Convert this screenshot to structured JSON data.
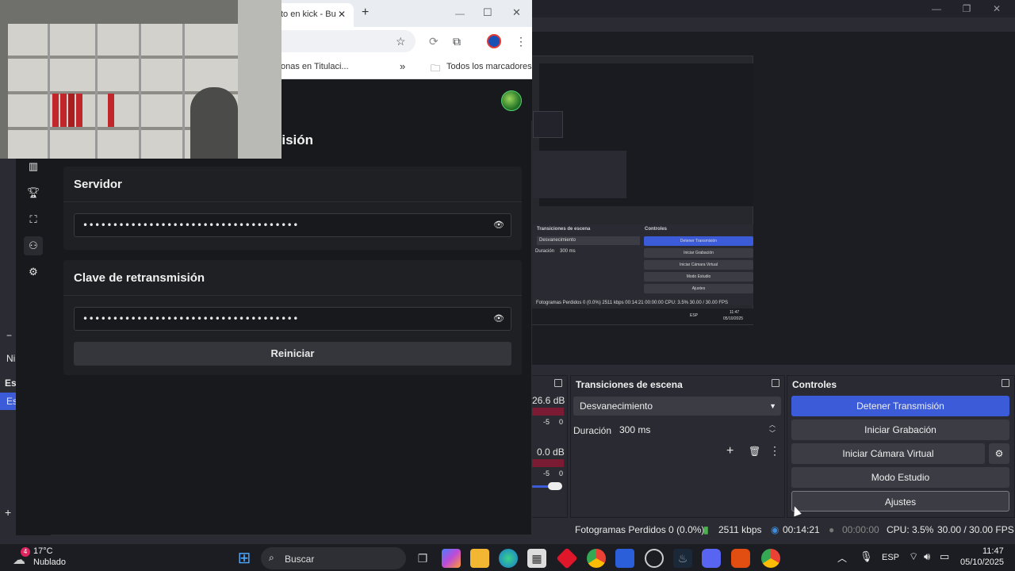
{
  "browser": {
    "tab_title": "to en kick - Bu",
    "new_tab": "+",
    "bookmarks_partial": "onas en Titulaci...",
    "bookmarks_more": "»",
    "all_bookmarks": "Todos los marcadores"
  },
  "kick": {
    "section_title_partial": "nisión",
    "server_card": {
      "title": "Servidor",
      "dots": "••••••••••••••••••••••••••••••••••••"
    },
    "key_card": {
      "title": "Clave de retransmisión",
      "dots": "••••••••••••••••••••••••••••••••••••"
    },
    "reset_label": "Reiniciar",
    "sidebar_icons": [
      "chart-icon",
      "trophy-icon",
      "scan-icon",
      "user-settings-icon",
      "gear-icon"
    ]
  },
  "obs": {
    "left_partial": {
      "minus": "−",
      "ni": "Ni",
      "es": "Es",
      "es2": "Es",
      "plus": "+"
    },
    "audio": {
      "db1": "26.6 dB",
      "scale1": [
        "-5",
        "0"
      ],
      "db2": "0.0 dB",
      "scale2": [
        "-5",
        "0"
      ]
    },
    "transitions": {
      "title": "Transiciones de escena",
      "transition": "Desvanecimiento",
      "duration_label": "Duración",
      "duration_value": "300 ms"
    },
    "controls": {
      "title": "Controles",
      "stop_stream": "Detener Transmisión",
      "start_recording": "Iniciar Grabación",
      "virtual_cam": "Iniciar Cámara Virtual",
      "studio_mode": "Modo Estudio",
      "settings": "Ajustes"
    },
    "status": {
      "dropped_frames": "Fotogramas Perdidos 0 (0.0%)",
      "bitrate": "2511 kbps",
      "stream_time": "00:14:21",
      "rec_time": "00:00:00",
      "cpu": "CPU: 3.5%",
      "fps": "30.00 / 30.00 FPS"
    },
    "nested": {
      "transitions_title": "Transiciones de escena",
      "controls_title": "Controles",
      "transition": "Desvanecimiento",
      "duration_label": "Duración",
      "duration_value": "300 ms",
      "stop_stream": "Detener Transmisión",
      "start_recording": "Iniciar Grabación",
      "virtual_cam": "Iniciar Cámara Virtual",
      "studio_mode": "Modo Estudio",
      "settings": "Ajustes",
      "status": "Fotogramas Perdidos 0 (0.0%)   2511 kbps   00:14:21   00:00:00   CPU: 3.5%   30.00 / 30.00 FPS",
      "clock": "11:47",
      "date": "05/10/2025",
      "lang": "ESP"
    }
  },
  "taskbar": {
    "weather_temp": "17°C",
    "weather_desc": "Nublado",
    "weather_badge": "4",
    "search_placeholder": "Buscar",
    "lang": "ESP",
    "time": "11:47",
    "date": "05/10/2025"
  },
  "colors": {
    "accent_blue": "#3b5bd9",
    "kick_green": "#53fc18",
    "obs_bg": "#2b2c33"
  }
}
